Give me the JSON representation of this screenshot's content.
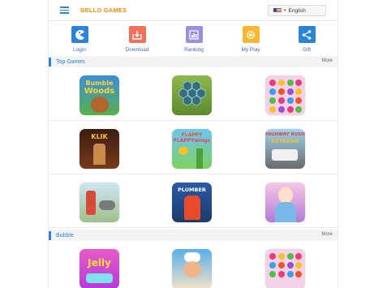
{
  "header": {
    "brand": "BELLO GAMES",
    "language": "English",
    "caret": "▾"
  },
  "nav": [
    {
      "label": "Login",
      "icon": "pacman-icon",
      "color": "#2b84d8"
    },
    {
      "label": "Download",
      "icon": "download-tray-icon",
      "color": "#f2715a"
    },
    {
      "label": "Ranking",
      "icon": "ranking-icon",
      "color": "#9c8fe0"
    },
    {
      "label": "My Play",
      "icon": "gear-icon",
      "color": "#f7b731"
    },
    {
      "label": "Gift",
      "icon": "share-icon",
      "color": "#2b84d8"
    }
  ],
  "sections": [
    {
      "title": "Top Games",
      "more": "More"
    },
    {
      "title": "Bubble",
      "more": "More"
    }
  ],
  "tiles": {
    "bumble": {
      "line1": "Bumble",
      "line2": "Woods"
    },
    "klik": {
      "text": "KLIK"
    },
    "flappy": {
      "line1": "FLAPPY",
      "line2": "FLAPPYwings"
    },
    "highway": {
      "line1": "HIGHWAY RUSH",
      "line2": "EXTREME"
    },
    "plumber": {
      "text": "PLUMBER"
    },
    "jelly": {
      "text": "Jelly"
    }
  },
  "colors": {
    "accent": "#2b84d8",
    "brand": "#ff8a00"
  }
}
